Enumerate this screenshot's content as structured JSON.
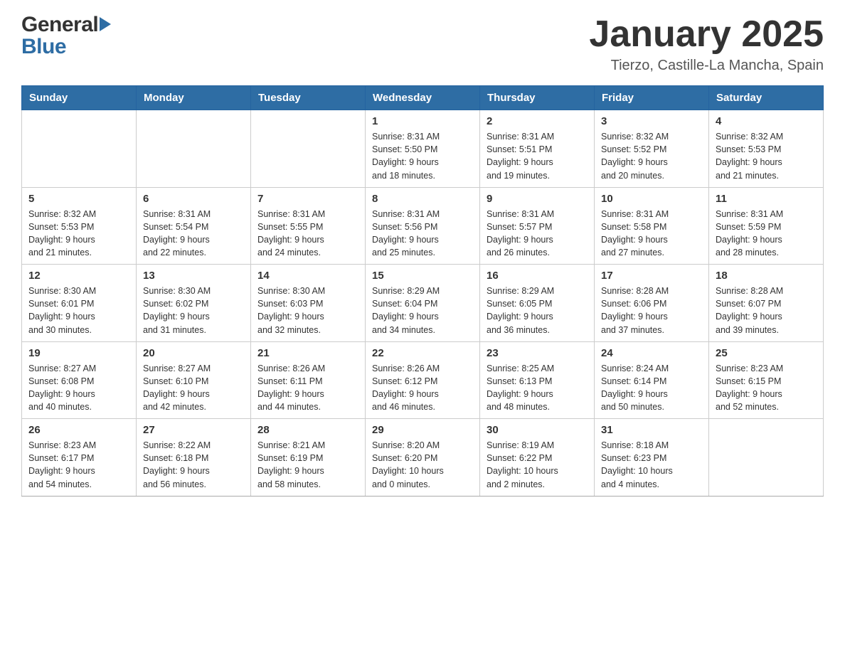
{
  "header": {
    "title": "January 2025",
    "subtitle": "Tierzo, Castille-La Mancha, Spain",
    "logo_general": "General",
    "logo_blue": "Blue"
  },
  "weekdays": [
    "Sunday",
    "Monday",
    "Tuesday",
    "Wednesday",
    "Thursday",
    "Friday",
    "Saturday"
  ],
  "weeks": [
    [
      {
        "day": "",
        "info": ""
      },
      {
        "day": "",
        "info": ""
      },
      {
        "day": "",
        "info": ""
      },
      {
        "day": "1",
        "info": "Sunrise: 8:31 AM\nSunset: 5:50 PM\nDaylight: 9 hours\nand 18 minutes."
      },
      {
        "day": "2",
        "info": "Sunrise: 8:31 AM\nSunset: 5:51 PM\nDaylight: 9 hours\nand 19 minutes."
      },
      {
        "day": "3",
        "info": "Sunrise: 8:32 AM\nSunset: 5:52 PM\nDaylight: 9 hours\nand 20 minutes."
      },
      {
        "day": "4",
        "info": "Sunrise: 8:32 AM\nSunset: 5:53 PM\nDaylight: 9 hours\nand 21 minutes."
      }
    ],
    [
      {
        "day": "5",
        "info": "Sunrise: 8:32 AM\nSunset: 5:53 PM\nDaylight: 9 hours\nand 21 minutes."
      },
      {
        "day": "6",
        "info": "Sunrise: 8:31 AM\nSunset: 5:54 PM\nDaylight: 9 hours\nand 22 minutes."
      },
      {
        "day": "7",
        "info": "Sunrise: 8:31 AM\nSunset: 5:55 PM\nDaylight: 9 hours\nand 24 minutes."
      },
      {
        "day": "8",
        "info": "Sunrise: 8:31 AM\nSunset: 5:56 PM\nDaylight: 9 hours\nand 25 minutes."
      },
      {
        "day": "9",
        "info": "Sunrise: 8:31 AM\nSunset: 5:57 PM\nDaylight: 9 hours\nand 26 minutes."
      },
      {
        "day": "10",
        "info": "Sunrise: 8:31 AM\nSunset: 5:58 PM\nDaylight: 9 hours\nand 27 minutes."
      },
      {
        "day": "11",
        "info": "Sunrise: 8:31 AM\nSunset: 5:59 PM\nDaylight: 9 hours\nand 28 minutes."
      }
    ],
    [
      {
        "day": "12",
        "info": "Sunrise: 8:30 AM\nSunset: 6:01 PM\nDaylight: 9 hours\nand 30 minutes."
      },
      {
        "day": "13",
        "info": "Sunrise: 8:30 AM\nSunset: 6:02 PM\nDaylight: 9 hours\nand 31 minutes."
      },
      {
        "day": "14",
        "info": "Sunrise: 8:30 AM\nSunset: 6:03 PM\nDaylight: 9 hours\nand 32 minutes."
      },
      {
        "day": "15",
        "info": "Sunrise: 8:29 AM\nSunset: 6:04 PM\nDaylight: 9 hours\nand 34 minutes."
      },
      {
        "day": "16",
        "info": "Sunrise: 8:29 AM\nSunset: 6:05 PM\nDaylight: 9 hours\nand 36 minutes."
      },
      {
        "day": "17",
        "info": "Sunrise: 8:28 AM\nSunset: 6:06 PM\nDaylight: 9 hours\nand 37 minutes."
      },
      {
        "day": "18",
        "info": "Sunrise: 8:28 AM\nSunset: 6:07 PM\nDaylight: 9 hours\nand 39 minutes."
      }
    ],
    [
      {
        "day": "19",
        "info": "Sunrise: 8:27 AM\nSunset: 6:08 PM\nDaylight: 9 hours\nand 40 minutes."
      },
      {
        "day": "20",
        "info": "Sunrise: 8:27 AM\nSunset: 6:10 PM\nDaylight: 9 hours\nand 42 minutes."
      },
      {
        "day": "21",
        "info": "Sunrise: 8:26 AM\nSunset: 6:11 PM\nDaylight: 9 hours\nand 44 minutes."
      },
      {
        "day": "22",
        "info": "Sunrise: 8:26 AM\nSunset: 6:12 PM\nDaylight: 9 hours\nand 46 minutes."
      },
      {
        "day": "23",
        "info": "Sunrise: 8:25 AM\nSunset: 6:13 PM\nDaylight: 9 hours\nand 48 minutes."
      },
      {
        "day": "24",
        "info": "Sunrise: 8:24 AM\nSunset: 6:14 PM\nDaylight: 9 hours\nand 50 minutes."
      },
      {
        "day": "25",
        "info": "Sunrise: 8:23 AM\nSunset: 6:15 PM\nDaylight: 9 hours\nand 52 minutes."
      }
    ],
    [
      {
        "day": "26",
        "info": "Sunrise: 8:23 AM\nSunset: 6:17 PM\nDaylight: 9 hours\nand 54 minutes."
      },
      {
        "day": "27",
        "info": "Sunrise: 8:22 AM\nSunset: 6:18 PM\nDaylight: 9 hours\nand 56 minutes."
      },
      {
        "day": "28",
        "info": "Sunrise: 8:21 AM\nSunset: 6:19 PM\nDaylight: 9 hours\nand 58 minutes."
      },
      {
        "day": "29",
        "info": "Sunrise: 8:20 AM\nSunset: 6:20 PM\nDaylight: 10 hours\nand 0 minutes."
      },
      {
        "day": "30",
        "info": "Sunrise: 8:19 AM\nSunset: 6:22 PM\nDaylight: 10 hours\nand 2 minutes."
      },
      {
        "day": "31",
        "info": "Sunrise: 8:18 AM\nSunset: 6:23 PM\nDaylight: 10 hours\nand 4 minutes."
      },
      {
        "day": "",
        "info": ""
      }
    ]
  ]
}
